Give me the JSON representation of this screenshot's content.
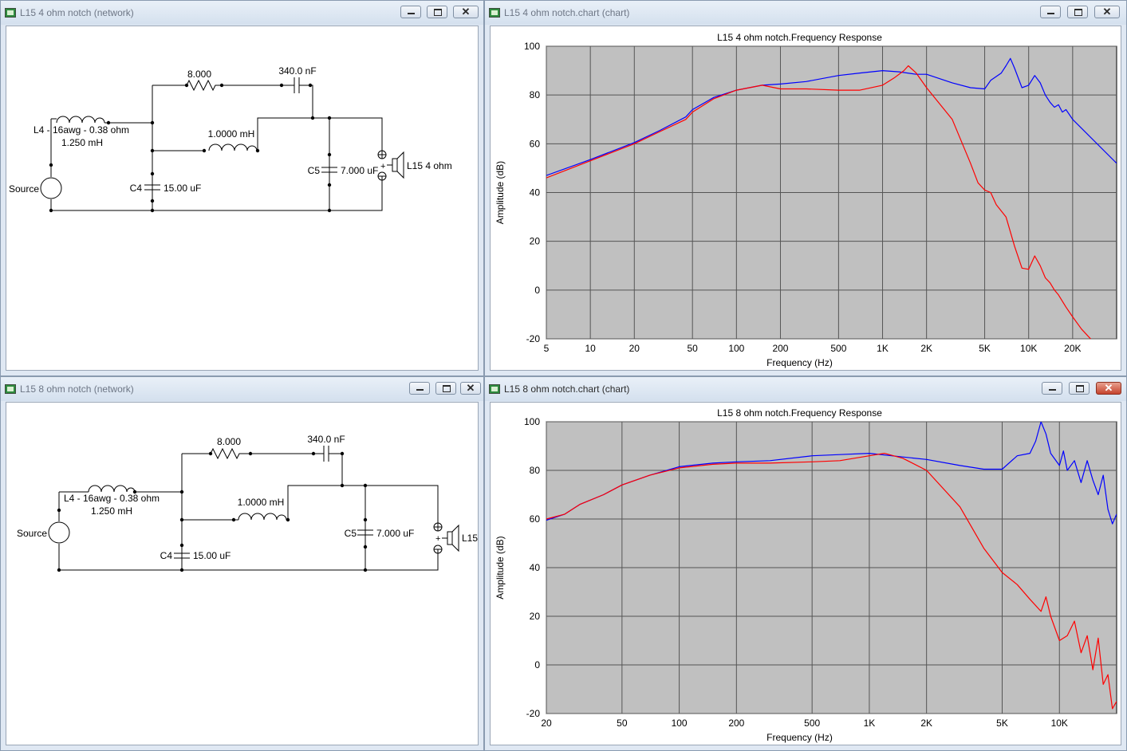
{
  "windows": {
    "net1": {
      "title": "L15 4 ohm notch (network)"
    },
    "chart1": {
      "title": "L15 4 ohm notch.chart (chart)"
    },
    "net2": {
      "title": "L15 8 ohm notch (network)"
    },
    "chart2": {
      "title": "L15 8 ohm notch.chart (chart)"
    }
  },
  "controls": {
    "close_glyph": "✕"
  },
  "net1": {
    "r1": "8.000",
    "c2": "340.0 nF",
    "l4_name": "L4 - 16awg - 0.38 ohm",
    "l4_value": "1.250 mH",
    "l5": "1.0000 mH",
    "c5": "C5",
    "c5_value": "7.000 uF",
    "c4": "C4",
    "c4_value": "15.00 uF",
    "source": "Source",
    "speaker": "L15 4 ohm",
    "plus": "+"
  },
  "net2": {
    "r1": "8.000",
    "c2": "340.0 nF",
    "l4_name": "L4 - 16awg - 0.38 ohm",
    "l4_value": "1.250 mH",
    "l5": "1.0000 mH",
    "c5": "C5",
    "c5_value": "7.000 uF",
    "c4": "C4",
    "c4_value": "15.00 uF",
    "source": "Source",
    "speaker": "L15",
    "plus": "+"
  },
  "colors": {
    "series_blue": "#0000ff",
    "series_red": "#ff0000",
    "plot_bg": "#c0c0c0",
    "grid": "#555555"
  },
  "chart_data": [
    {
      "type": "line",
      "title": "L15 4 ohm notch.Frequency Response",
      "xlabel": "Frequency (Hz)",
      "ylabel": "Amplitude (dB)",
      "x_scale": "log",
      "xlim": [
        5,
        40000
      ],
      "ylim": [
        -20,
        100
      ],
      "grid": true,
      "x_ticks": [
        5,
        10,
        20,
        50,
        100,
        200,
        500,
        1000,
        2000,
        5000,
        10000,
        20000
      ],
      "x_tick_labels": [
        "5",
        "10",
        "20",
        "50",
        "100",
        "200",
        "500",
        "1K",
        "2K",
        "5K",
        "10K",
        "20K"
      ],
      "y_ticks": [
        -20,
        0,
        20,
        40,
        60,
        80,
        100
      ],
      "y_tick_labels": [
        "-20",
        "0",
        "20",
        "40",
        "60",
        "80",
        "100"
      ],
      "series": [
        {
          "color": "#0000ff",
          "points": [
            [
              5,
              47
            ],
            [
              10,
              53.5
            ],
            [
              20,
              60.5
            ],
            [
              30,
              65.5
            ],
            [
              45,
              71
            ],
            [
              50,
              74
            ],
            [
              70,
              79
            ],
            [
              100,
              82
            ],
            [
              150,
              84
            ],
            [
              200,
              84.5
            ],
            [
              300,
              85.5
            ],
            [
              500,
              88
            ],
            [
              700,
              89
            ],
            [
              1000,
              90
            ],
            [
              1300,
              89.5
            ],
            [
              1700,
              88.5
            ],
            [
              2000,
              88.5
            ],
            [
              3000,
              85
            ],
            [
              4000,
              83
            ],
            [
              5000,
              82.5
            ],
            [
              5500,
              86
            ],
            [
              6500,
              89
            ],
            [
              7000,
              92
            ],
            [
              7500,
              95
            ],
            [
              8000,
              91
            ],
            [
              9000,
              83
            ],
            [
              10000,
              84
            ],
            [
              11000,
              88
            ],
            [
              12000,
              85
            ],
            [
              13000,
              80
            ],
            [
              14000,
              77
            ],
            [
              15000,
              75
            ],
            [
              16000,
              76
            ],
            [
              17000,
              73
            ],
            [
              18000,
              74
            ],
            [
              20000,
              70
            ],
            [
              40000,
              52
            ]
          ]
        },
        {
          "color": "#ff0000",
          "points": [
            [
              5,
              46
            ],
            [
              10,
              53
            ],
            [
              20,
              60
            ],
            [
              30,
              65
            ],
            [
              45,
              70
            ],
            [
              50,
              73
            ],
            [
              70,
              78.5
            ],
            [
              100,
              82
            ],
            [
              150,
              84
            ],
            [
              200,
              82.5
            ],
            [
              300,
              82.5
            ],
            [
              500,
              82
            ],
            [
              700,
              82
            ],
            [
              1000,
              84
            ],
            [
              1200,
              87
            ],
            [
              1400,
              90
            ],
            [
              1500,
              92
            ],
            [
              1700,
              89
            ],
            [
              2000,
              83
            ],
            [
              3000,
              70
            ],
            [
              4000,
              52
            ],
            [
              4500,
              44
            ],
            [
              5000,
              41
            ],
            [
              5500,
              40
            ],
            [
              6000,
              35
            ],
            [
              7000,
              30
            ],
            [
              8000,
              18
            ],
            [
              9000,
              9
            ],
            [
              10000,
              8.5
            ],
            [
              11000,
              14
            ],
            [
              12000,
              10
            ],
            [
              13000,
              5
            ],
            [
              14000,
              3
            ],
            [
              15000,
              0
            ],
            [
              16000,
              -2
            ],
            [
              18000,
              -7
            ],
            [
              20000,
              -11
            ],
            [
              23000,
              -16
            ],
            [
              27000,
              -20.5
            ]
          ]
        }
      ]
    },
    {
      "type": "line",
      "title": "L15 8 ohm notch.Frequency Response",
      "xlabel": "Frequency (Hz)",
      "ylabel": "Amplitude (dB)",
      "x_scale": "log",
      "xlim": [
        20,
        20000
      ],
      "ylim": [
        -20,
        100
      ],
      "grid": true,
      "x_ticks": [
        20,
        50,
        100,
        200,
        500,
        1000,
        2000,
        5000,
        10000
      ],
      "x_tick_labels": [
        "20",
        "50",
        "100",
        "200",
        "500",
        "1K",
        "2K",
        "5K",
        "10K"
      ],
      "y_ticks": [
        -20,
        0,
        20,
        40,
        60,
        80,
        100
      ],
      "y_tick_labels": [
        "-20",
        "0",
        "20",
        "40",
        "60",
        "80",
        "100"
      ],
      "series": [
        {
          "color": "#0000ff",
          "points": [
            [
              20,
              59.5
            ],
            [
              25,
              62
            ],
            [
              30,
              66
            ],
            [
              40,
              70
            ],
            [
              50,
              74
            ],
            [
              70,
              78
            ],
            [
              100,
              81.5
            ],
            [
              150,
              83
            ],
            [
              200,
              83.5
            ],
            [
              300,
              84
            ],
            [
              500,
              86
            ],
            [
              700,
              86.5
            ],
            [
              1000,
              87
            ],
            [
              1500,
              85.5
            ],
            [
              2000,
              84.5
            ],
            [
              3000,
              82
            ],
            [
              4000,
              80.5
            ],
            [
              5000,
              80.5
            ],
            [
              6000,
              86
            ],
            [
              7000,
              87
            ],
            [
              7500,
              92
            ],
            [
              8000,
              100
            ],
            [
              8500,
              95
            ],
            [
              9000,
              87
            ],
            [
              10000,
              82
            ],
            [
              10500,
              88
            ],
            [
              11000,
              80
            ],
            [
              12000,
              84
            ],
            [
              13000,
              75
            ],
            [
              14000,
              84
            ],
            [
              15000,
              76
            ],
            [
              16000,
              70
            ],
            [
              17000,
              78
            ],
            [
              18000,
              64
            ],
            [
              19000,
              58
            ],
            [
              20000,
              62
            ]
          ]
        },
        {
          "color": "#ff0000",
          "points": [
            [
              20,
              60
            ],
            [
              25,
              62
            ],
            [
              30,
              66
            ],
            [
              40,
              70
            ],
            [
              50,
              74
            ],
            [
              70,
              78
            ],
            [
              100,
              81
            ],
            [
              150,
              82.5
            ],
            [
              200,
              83
            ],
            [
              300,
              83
            ],
            [
              500,
              83.5
            ],
            [
              700,
              84
            ],
            [
              1000,
              86
            ],
            [
              1200,
              87
            ],
            [
              1500,
              85
            ],
            [
              2000,
              80
            ],
            [
              3000,
              65
            ],
            [
              4000,
              48
            ],
            [
              5000,
              38
            ],
            [
              6000,
              33
            ],
            [
              7000,
              27
            ],
            [
              8000,
              22
            ],
            [
              8500,
              28
            ],
            [
              9000,
              20
            ],
            [
              10000,
              10
            ],
            [
              11000,
              12
            ],
            [
              12000,
              18
            ],
            [
              13000,
              5
            ],
            [
              14000,
              12
            ],
            [
              15000,
              -2
            ],
            [
              16000,
              11
            ],
            [
              17000,
              -8
            ],
            [
              18000,
              -4
            ],
            [
              19000,
              -18
            ],
            [
              20000,
              -15
            ]
          ]
        }
      ]
    }
  ]
}
